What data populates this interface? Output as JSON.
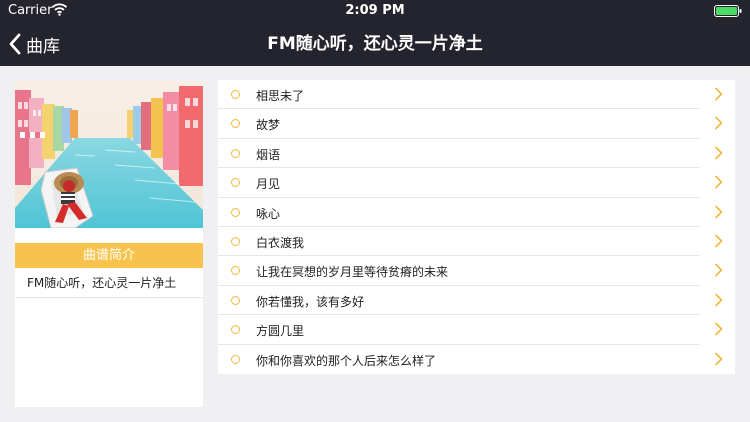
{
  "status_bar": {
    "carrier": "Carrier",
    "time": "2:09 PM"
  },
  "nav": {
    "back_label": "曲库",
    "title": "FM随心听，还心灵一片净土"
  },
  "sidebar": {
    "intro_header": "曲谱简介",
    "intro_text": "FM随心听，还心灵一片净土"
  },
  "songs": [
    "相思未了",
    "故梦",
    "烟语",
    "月见",
    "咏心",
    "白衣渡我",
    "让我在冥想的岁月里等待贫瘠的未来",
    "你若懂我，该有多好",
    "方圆几里",
    "你和你喜欢的那个人后来怎么样了"
  ],
  "colors": {
    "bar": "#24242e",
    "accent": "#f8c34d",
    "background": "#f0f0f2",
    "battery": "#4cd964"
  },
  "icons": {
    "back": "chevron-left-icon",
    "row_arrow": "chevron-right-icon",
    "row_bullet": "circle-icon",
    "wifi": "wifi-icon",
    "battery": "battery-icon"
  }
}
